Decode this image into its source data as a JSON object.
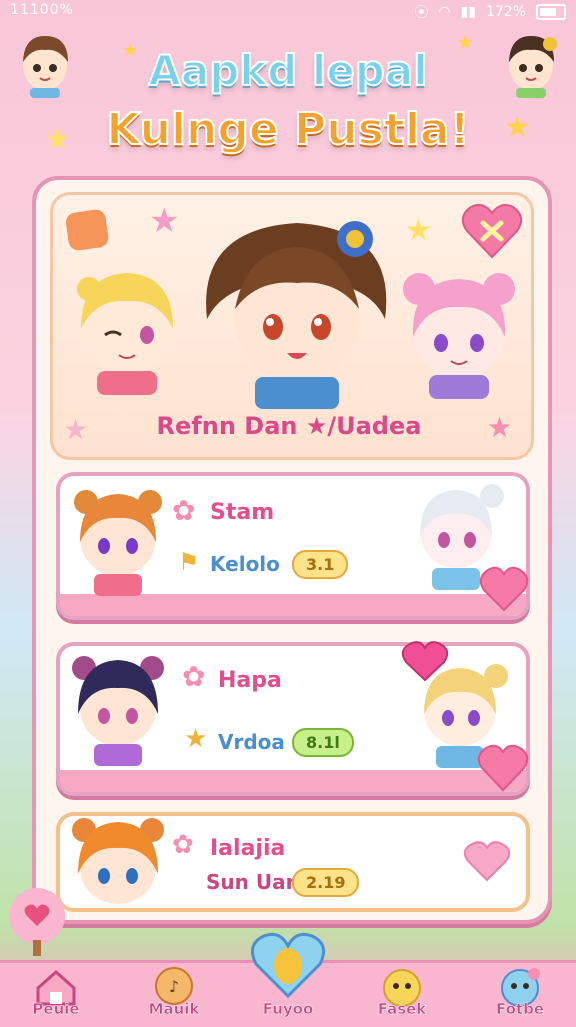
{
  "status_bar": {
    "left": "11100%",
    "right": "172%"
  },
  "header": {
    "title_line1": "Aapkd lepal",
    "title_line2": "Kulnge Pustla!"
  },
  "featured": {
    "label": "Refnn Dan ★/Uadea"
  },
  "cards": [
    {
      "name": "Stam",
      "sub": "Kelolo",
      "value": "3.1",
      "pill_style": "yellow"
    },
    {
      "name": "Hapa",
      "sub": "Vrdoa",
      "value": "8.1l",
      "pill_style": "green"
    },
    {
      "name": "Ialajia",
      "sub": "Sun Uar",
      "value": "2.19",
      "pill_style": "yellow"
    }
  ],
  "nav": [
    {
      "label": "Peuie",
      "icon": "home-icon"
    },
    {
      "label": "Mauik",
      "icon": "music-icon"
    },
    {
      "label": "Fuyoo",
      "icon": "heart-gem-icon"
    },
    {
      "label": "Fasek",
      "icon": "chick-icon"
    },
    {
      "label": "Fotbe",
      "icon": "pet-icon"
    }
  ],
  "colors": {
    "accent_pink": "#e04f8e",
    "accent_blue": "#4b8fcf",
    "panel_border": "#e694b4"
  }
}
